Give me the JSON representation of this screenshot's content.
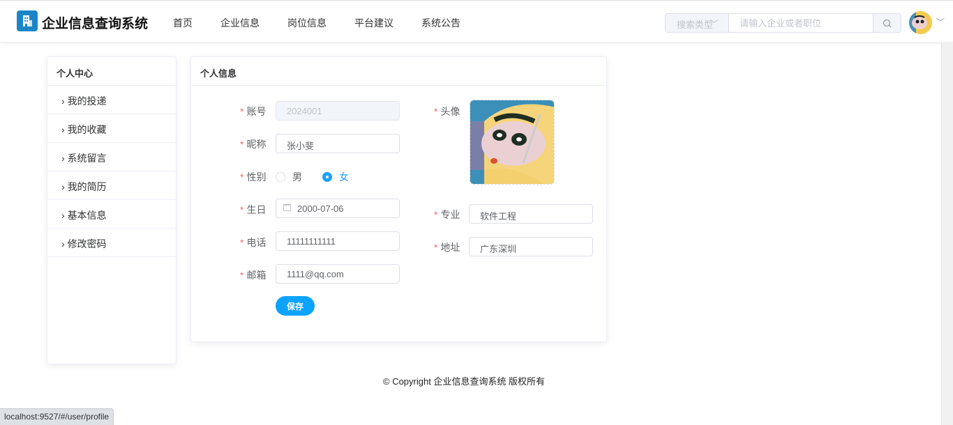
{
  "header": {
    "brand": "企业信息查询系统",
    "nav": [
      "首页",
      "企业信息",
      "岗位信息",
      "平台建议",
      "系统公告"
    ],
    "search_type": "搜索类型",
    "search_placeholder": "请输入企业或者职位"
  },
  "sidebar": {
    "title": "个人中心",
    "items": [
      "我的投递",
      "我的收藏",
      "系统留言",
      "我的简历",
      "基本信息",
      "修改密码"
    ]
  },
  "profile": {
    "title": "个人信息",
    "labels": {
      "account": "账号",
      "nickname": "昵称",
      "gender": "性别",
      "birthday": "生日",
      "phone": "电话",
      "email": "邮箱",
      "avatar": "头像",
      "major": "专业",
      "address": "地址"
    },
    "account": "2024001",
    "nickname": "张小斐",
    "gender_options": [
      "男",
      "女"
    ],
    "gender_selected": "女",
    "birthday": "2000-07-06",
    "phone": "11111111111",
    "email": "1111@qq.com",
    "major": "软件工程",
    "address": "广东深圳",
    "save": "保存"
  },
  "footer": "© Copyright 企业信息查询系统 版权所有",
  "status_url": "localhost:9527/#/user/profile",
  "colors": {
    "primary": "#0ba3ff",
    "required": "#f56c6c",
    "logo": "#1a86c8"
  }
}
